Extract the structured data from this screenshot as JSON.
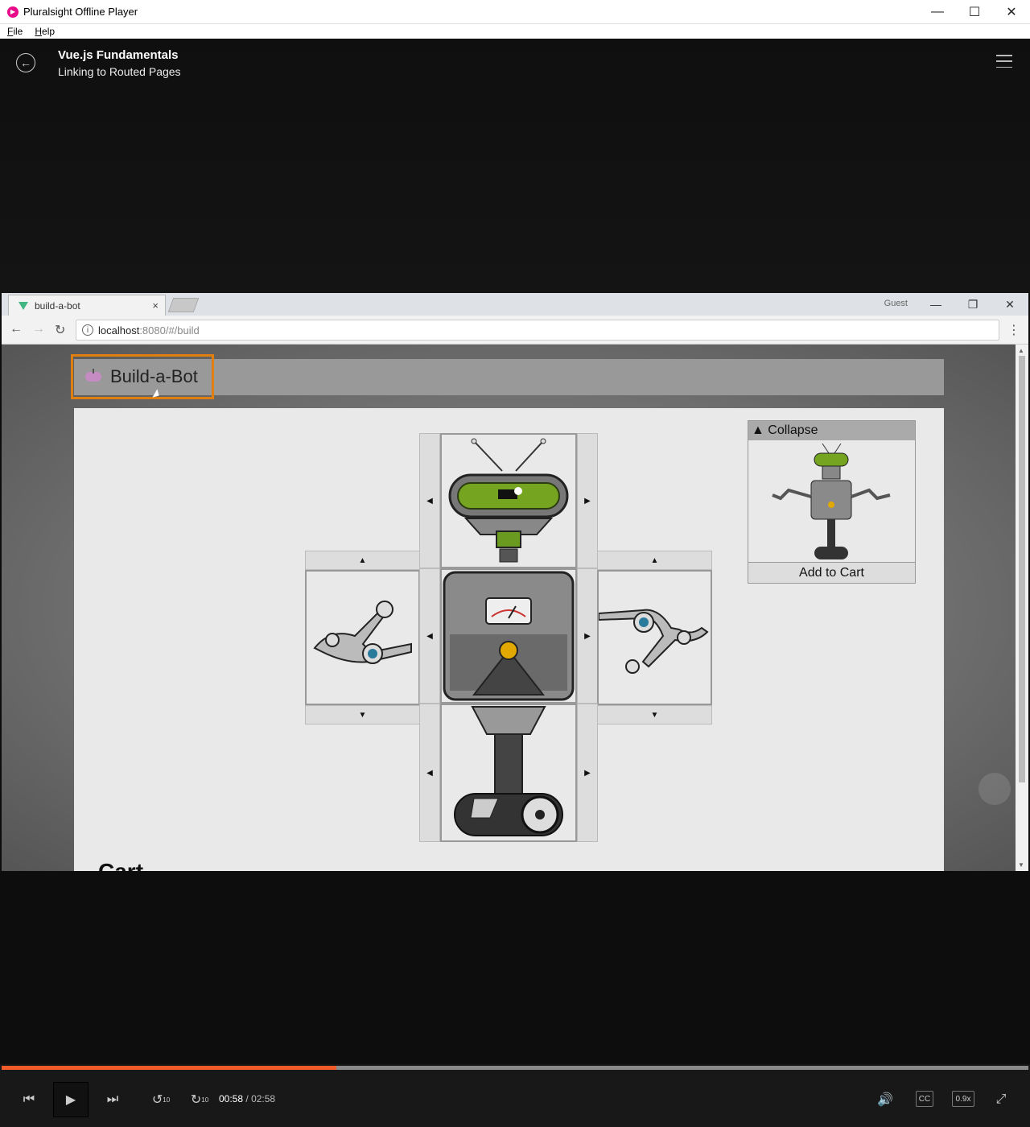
{
  "window": {
    "title": "Pluralsight Offline Player",
    "minimize": "—",
    "maximize": "☐",
    "close": "✕"
  },
  "menu": {
    "items": [
      "File",
      "Help"
    ]
  },
  "header": {
    "course_title": "Vue.js Fundamentals",
    "clip_title": "Linking to Routed Pages"
  },
  "browser": {
    "tab_title": "build-a-bot",
    "tab_close": "×",
    "profile": "Guest",
    "url_host": "localhost",
    "url_rest": ":8080/#/build",
    "ctrl_min": "—",
    "ctrl_restore": "❐",
    "ctrl_close": "✕"
  },
  "site": {
    "title": "Build-a-Bot",
    "collapse_label": "▲ Collapse",
    "add_to_cart": "Add to Cart",
    "cart_heading": "Cart",
    "arrow_left": "◀",
    "arrow_right": "▶",
    "arrow_up": "▲",
    "arrow_down": "▼"
  },
  "player": {
    "current_time": "00:58",
    "separator": "/",
    "duration": "02:58",
    "progress": 0.326,
    "speed": "0.9x",
    "cc": "CC",
    "rewind_label": "10",
    "forward_label": "10"
  },
  "colors": {
    "accent": "#f15b2a",
    "highlight": "#e07f0f",
    "brand": "#e80a89"
  }
}
